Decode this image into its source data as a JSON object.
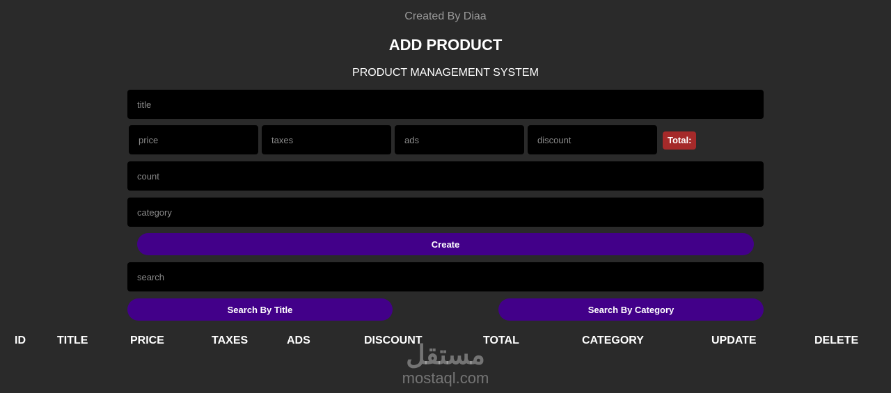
{
  "header": {
    "credit": "Created By Diaa",
    "title": "ADD PRODUCT",
    "subtitle": "PRODUCT MANAGEMENT SYSTEM"
  },
  "form": {
    "title_placeholder": "title",
    "price_placeholder": "price",
    "taxes_placeholder": "taxes",
    "ads_placeholder": "ads",
    "discount_placeholder": "discount",
    "total_label": "Total:",
    "count_placeholder": "count",
    "category_placeholder": "category",
    "create_label": "Create"
  },
  "search": {
    "placeholder": "search",
    "by_title_label": "Search By Title",
    "by_category_label": "Search By Category"
  },
  "table": {
    "headers": [
      "ID",
      "TITLE",
      "PRICE",
      "TAXES",
      "ADS",
      "DISCOUNT",
      "TOTAL",
      "CATEGORY",
      "UPDATE",
      "DELETE"
    ]
  },
  "watermark": {
    "arabic": "مستقل",
    "latin": "mostaql.com"
  },
  "colors": {
    "background": "#2a2a2a",
    "input": "#000000",
    "button": "#420089",
    "total_badge": "#a52a2a"
  }
}
